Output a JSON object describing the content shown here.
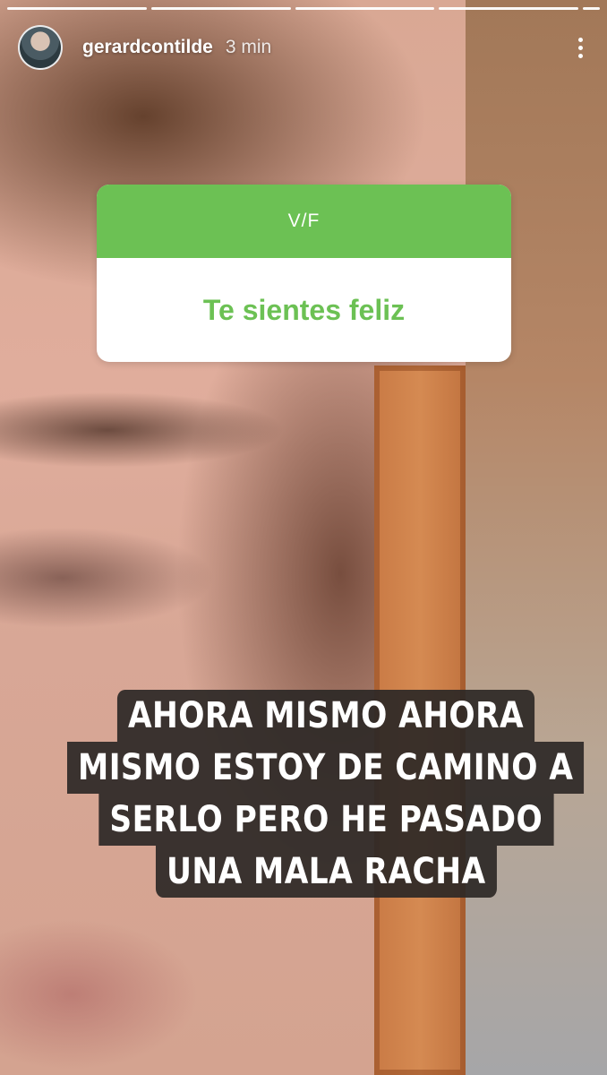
{
  "story": {
    "username": "gerardcontilde",
    "time": "3 min",
    "progress_segments": 5,
    "current_segment": 5,
    "more_icon": "more-vertical-icon"
  },
  "quiz": {
    "header": "V/F",
    "question": "Te sientes feliz",
    "accent_color": "#6cc154"
  },
  "caption": {
    "lines": [
      "AHORA MISMO AHORA",
      "MISMO ESTOY DE CAMINO A",
      "SERLO PERO HE PASADO",
      "UNA MALA RACHA"
    ]
  }
}
